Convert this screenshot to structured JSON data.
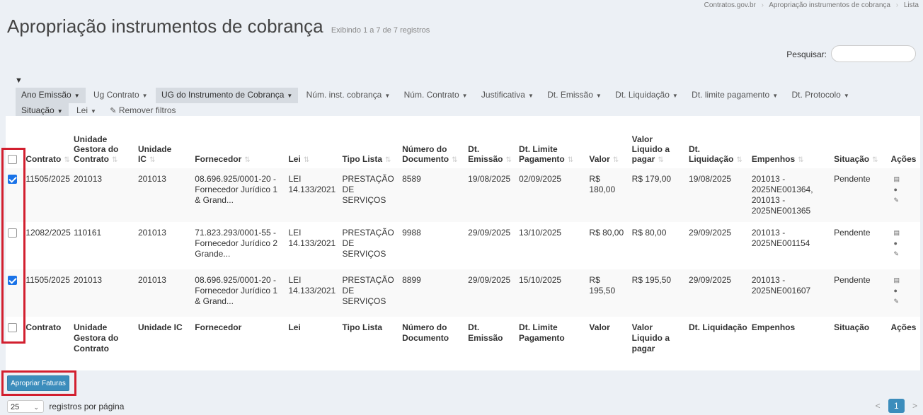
{
  "breadcrumb": [
    "Contratos.gov.br",
    "Apropriação instrumentos de cobrança",
    "Lista"
  ],
  "page": {
    "title": "Apropriação instrumentos de cobrança",
    "subtitle": "Exibindo 1 a 7 de 7 registros"
  },
  "search": {
    "label": "Pesquisar:",
    "value": ""
  },
  "filters": [
    {
      "label": "Ano Emissão",
      "active": true
    },
    {
      "label": "Ug Contrato",
      "active": false
    },
    {
      "label": "UG do Instrumento de Cobrança",
      "active": true
    },
    {
      "label": "Núm. inst. cobrança",
      "active": false
    },
    {
      "label": "Núm. Contrato",
      "active": false
    },
    {
      "label": "Justificativa",
      "active": false
    },
    {
      "label": "Dt. Emissão",
      "active": false
    },
    {
      "label": "Dt. Liquidação",
      "active": false
    },
    {
      "label": "Dt. limite pagamento",
      "active": false
    },
    {
      "label": "Dt. Protocolo",
      "active": false
    },
    {
      "label": "Situação",
      "active": true
    },
    {
      "label": "Lei",
      "active": false
    }
  ],
  "remove_filters": "Remover filtros",
  "table": {
    "headers": [
      "Contrato",
      "Unidade Gestora do Contrato",
      "Unidade IC",
      "Fornecedor",
      "Lei",
      "Tipo Lista",
      "Número do Documento",
      "Dt. Emissão",
      "Dt. Limite Pagamento",
      "Valor",
      "Valor Liquido a pagar",
      "Dt. Liquidação",
      "Empenhos",
      "Situação",
      "Ações"
    ],
    "footer": [
      "Contrato",
      "Unidade Gestora do Contrato",
      "Unidade IC",
      "Fornecedor",
      "Lei",
      "Tipo Lista",
      "Número do Documento",
      "Dt. Emissão",
      "Dt. Limite Pagamento",
      "Valor",
      "Valor Liquido a pagar",
      "Dt. Liquidação",
      "Empenhos",
      "Situação",
      "Ações"
    ],
    "rows": [
      {
        "checked": true,
        "cells": [
          "11505/2025",
          "201013",
          "201013",
          "08.696.925/0001-20 - Fornecedor Jurídico 1 & Grand...",
          "LEI 14.133/2021",
          "PRESTAÇÃO DE SERVIÇOS",
          "8589",
          "19/08/2025",
          "02/09/2025",
          "R$ 180,00",
          "R$ 179,00",
          "19/08/2025",
          "201013 - 2025NE001364, 201013 - 2025NE001365",
          "Pendente"
        ]
      },
      {
        "checked": false,
        "cells": [
          "12082/2025",
          "110161",
          "201013",
          "71.823.293/0001-55 - Fornecedor Jurídico 2 Grande...",
          "LEI 14.133/2021",
          "PRESTAÇÃO DE SERVIÇOS",
          "9988",
          "29/09/2025",
          "13/10/2025",
          "R$ 80,00",
          "R$ 80,00",
          "29/09/2025",
          "201013 - 2025NE001154",
          "Pendente"
        ]
      },
      {
        "checked": true,
        "cells": [
          "11505/2025",
          "201013",
          "201013",
          "08.696.925/0001-20 - Fornecedor Jurídico 1 & Grand...",
          "LEI 14.133/2021",
          "PRESTAÇÃO DE SERVIÇOS",
          "8899",
          "29/09/2025",
          "15/10/2025",
          "R$ 195,50",
          "R$ 195,50",
          "29/09/2025",
          "201013 - 2025NE001607",
          "Pendente"
        ]
      }
    ]
  },
  "apropriar_button": "Apropriar Faturas",
  "per_page": {
    "value": "25",
    "label": "registros por página"
  },
  "pagination": {
    "prev": "<",
    "current": "1",
    "next": ">"
  },
  "colors": {
    "primary": "#3c8dbc",
    "highlight": "#d21f2f",
    "checkbox": "#1a73e8"
  }
}
